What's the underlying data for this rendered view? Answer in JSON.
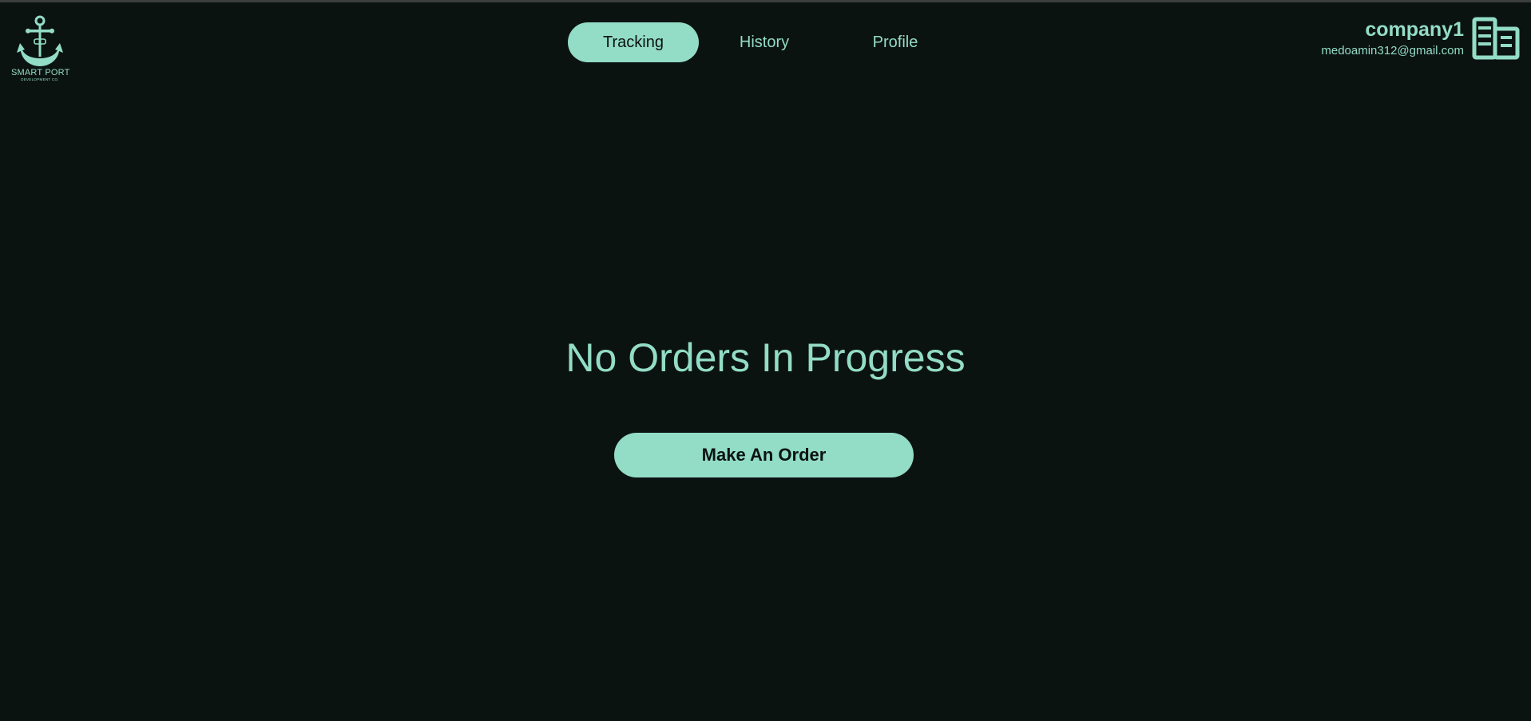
{
  "brand": {
    "name": "SMART PORT",
    "subtitle": "DEVELOPMENT CO.",
    "icon": "anchor-logo-icon"
  },
  "nav": {
    "tabs": [
      {
        "label": "Tracking",
        "active": true
      },
      {
        "label": "History",
        "active": false
      },
      {
        "label": "Profile",
        "active": false
      }
    ]
  },
  "user": {
    "name": "company1",
    "email": "medoamin312@gmail.com",
    "icon": "building-icon"
  },
  "main": {
    "empty_message": "No Orders In Progress",
    "action_label": "Make An Order"
  },
  "colors": {
    "background": "#0b1311",
    "accent": "#93dcc5"
  }
}
